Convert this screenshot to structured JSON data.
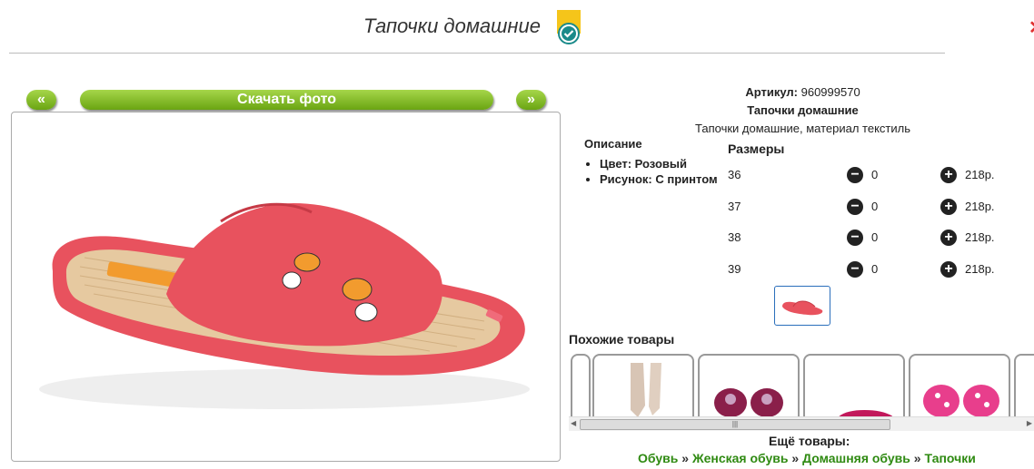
{
  "header": {
    "title": "Тапочки домашние"
  },
  "gallery": {
    "prev_label": "«",
    "download_label": "Скачать фото",
    "next_label": "»"
  },
  "product": {
    "article_label": "Артикул:",
    "article_value": "960999570",
    "name": "Тапочки домашние",
    "subtitle": "Тапочки домашние, материал текстиль"
  },
  "description": {
    "heading": "Описание",
    "items": [
      "Цвет: Розовый",
      "Рисунок: С принтом"
    ]
  },
  "sizes": {
    "heading": "Размеры",
    "rows": [
      {
        "size": "36",
        "qty": "0",
        "price": "218р."
      },
      {
        "size": "37",
        "qty": "0",
        "price": "218р."
      },
      {
        "size": "38",
        "qty": "0",
        "price": "218р."
      },
      {
        "size": "39",
        "qty": "0",
        "price": "218р."
      }
    ]
  },
  "similar": {
    "heading": "Похожие товары"
  },
  "more": {
    "heading": "Ещё товары:",
    "crumbs": [
      "Обувь",
      "Женская обувь",
      "Домашняя обувь",
      "Тапочки"
    ],
    "separator": "»"
  },
  "colors": {
    "accent_green": "#6aa512",
    "link_green": "#2f8a12",
    "slipper_pink": "#e8525e"
  }
}
